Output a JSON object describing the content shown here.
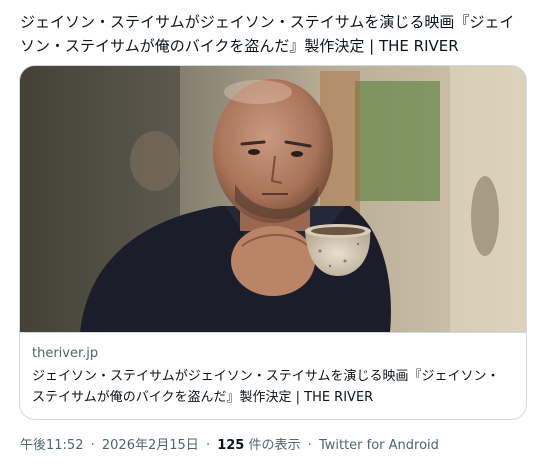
{
  "tweet": {
    "text": "ジェイソン・ステイサムがジェイソン・ステイサムを演じる映画『ジェイソン・ステイサムが俺のバイクを盗んだ』製作決定 | THE RIVER"
  },
  "card": {
    "domain": "theriver.jp",
    "title": "ジェイソン・ステイサムがジェイソン・ステイサムを演じる映画『ジェイソン・ステイサムが俺のバイクを盗んだ』製作決定 | THE RIVER"
  },
  "meta": {
    "time": "午後11:52",
    "separator": "·",
    "date": "2026年2月15日",
    "views_count": "125",
    "views_label": "件の表示",
    "source": "Twitter for Android"
  }
}
